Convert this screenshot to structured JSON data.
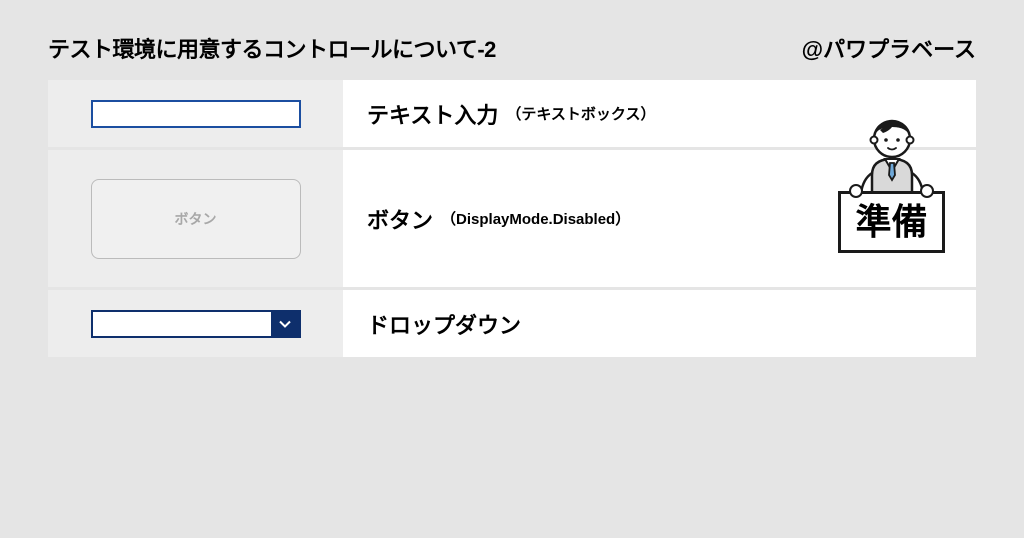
{
  "header": {
    "title": "テスト環境に用意するコントロールについて-2",
    "author": "@パワプラベース"
  },
  "rows": [
    {
      "control_label": "",
      "title": "テキスト入力",
      "subtitle": "（テキストボックス）"
    },
    {
      "control_label": "ボタン",
      "title": "ボタン",
      "subtitle": "（DisplayMode.Disabled）"
    },
    {
      "control_label": "",
      "title": "ドロップダウン",
      "subtitle": ""
    }
  ],
  "sign": "準備"
}
